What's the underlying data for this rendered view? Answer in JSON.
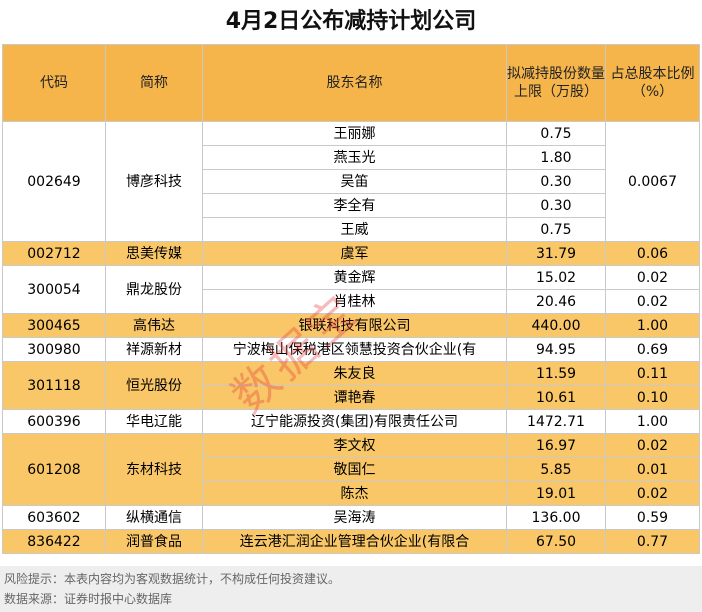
{
  "title": "4月2日公布减持计划公司",
  "headers": {
    "code": "代码",
    "name": "简称",
    "holder": "股东名称",
    "shares": "拟减持股份数量上限（万股）",
    "ratio": "占总股本比例（%）"
  },
  "companies": [
    {
      "code": "002649",
      "name": "博彦科技",
      "ratio": "0.0067",
      "highlight": false,
      "holders": [
        {
          "holder": "王丽娜",
          "shares": "0.75"
        },
        {
          "holder": "燕玉光",
          "shares": "1.80"
        },
        {
          "holder": "吴笛",
          "shares": "0.30"
        },
        {
          "holder": "李全有",
          "shares": "0.30"
        },
        {
          "holder": "王威",
          "shares": "0.75"
        }
      ]
    },
    {
      "code": "002712",
      "name": "思美传媒",
      "highlight": true,
      "holders": [
        {
          "holder": "虞军",
          "shares": "31.79",
          "ratio": "0.06"
        }
      ]
    },
    {
      "code": "300054",
      "name": "鼎龙股份",
      "highlight": false,
      "holders": [
        {
          "holder": "黄金辉",
          "shares": "15.02",
          "ratio": "0.02"
        },
        {
          "holder": "肖桂林",
          "shares": "20.46",
          "ratio": "0.02"
        }
      ]
    },
    {
      "code": "300465",
      "name": "高伟达",
      "highlight": true,
      "holders": [
        {
          "holder": "银联科技有限公司",
          "shares": "440.00",
          "ratio": "1.00"
        }
      ]
    },
    {
      "code": "300980",
      "name": "祥源新材",
      "highlight": false,
      "holders": [
        {
          "holder": "宁波梅山保税港区领慧投资合伙企业(有",
          "shares": "94.95",
          "ratio": "0.69"
        }
      ]
    },
    {
      "code": "301118",
      "name": "恒光股份",
      "highlight": true,
      "holders": [
        {
          "holder": "朱友良",
          "shares": "11.59",
          "ratio": "0.11"
        },
        {
          "holder": "谭艳春",
          "shares": "10.61",
          "ratio": "0.10"
        }
      ]
    },
    {
      "code": "600396",
      "name": "华电辽能",
      "highlight": false,
      "holders": [
        {
          "holder": "辽宁能源投资(集团)有限责任公司",
          "shares": "1472.71",
          "ratio": "1.00"
        }
      ]
    },
    {
      "code": "601208",
      "name": "东材科技",
      "highlight": true,
      "holders": [
        {
          "holder": "李文权",
          "shares": "16.97",
          "ratio": "0.02"
        },
        {
          "holder": "敬国仁",
          "shares": "5.85",
          "ratio": "0.01"
        },
        {
          "holder": "陈杰",
          "shares": "19.01",
          "ratio": "0.02"
        }
      ]
    },
    {
      "code": "603602",
      "name": "纵横通信",
      "highlight": false,
      "holders": [
        {
          "holder": "吴海涛",
          "shares": "136.00",
          "ratio": "0.59"
        }
      ]
    },
    {
      "code": "836422",
      "name": "润普食品",
      "highlight": true,
      "holders": [
        {
          "holder": "连云港汇润企业管理合伙企业(有限合",
          "shares": "67.50",
          "ratio": "0.77"
        }
      ]
    }
  ],
  "watermark": "数据宝",
  "footer": {
    "risk": "风险提示：本表内容均为客观数据统计，不构成任何投资建议。",
    "source": "数据来源：证券时报中心数据库"
  },
  "colors": {
    "header_bg": "#f6b54b",
    "highlight_row": "#f9c767"
  }
}
